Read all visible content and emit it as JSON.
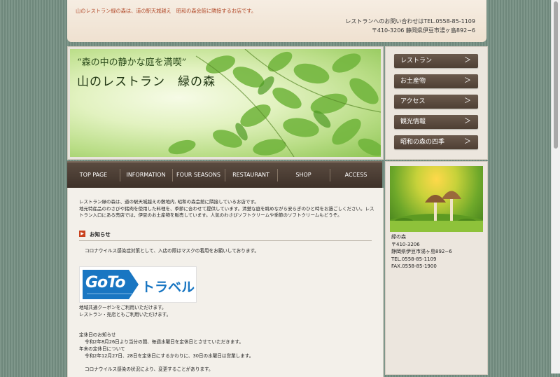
{
  "header": {
    "tagline": "山のレストラン緑の森は、道の駅天城越え　昭和の森会館に隣接するお店です。",
    "contact_line1": "レストランへのお問い合わせはTEL.0558-85-1109",
    "contact_line2": "〒410-3206 静岡県伊豆市湯ヶ島892−6"
  },
  "hero": {
    "catch": "“森の中の静かな庭を満喫”",
    "title": "山のレストラン　緑の森"
  },
  "side_menu": [
    {
      "label": "レストラン"
    },
    {
      "label": "お土産物"
    },
    {
      "label": "アクセス"
    },
    {
      "label": "観光情報"
    },
    {
      "label": "昭和の森の四季"
    }
  ],
  "arrow_glyph": "＞",
  "nav": [
    {
      "label": "TOP PAGE"
    },
    {
      "label": "INFORMATION"
    },
    {
      "label": "FOUR SEASONS"
    },
    {
      "label": "RESTAURANT"
    },
    {
      "label": "SHOP"
    },
    {
      "label": "ACCESS"
    }
  ],
  "content": {
    "intro": "レストラン緑の森は、道の駅天城越えの敷地内, 昭和の森会館に隣接しているお店です。\n地元特産品のわさびや猪肉を使用した料理を、季節に合わせて提供しています。清楚な庭を眺めながら安らぎのひと時をお過ごしください。レストラン入口にある売店では，伊豆のお土産物を販売しています。人気のわさびソフトクリームや季節のソフトクリームもどうぞ。",
    "news_label": "お知らせ",
    "bullet": "▶",
    "covid_notice": "コロナウイルス感染症対策として、入店の際はマスクの着用をお願いしております。",
    "goto_logo": "GoTo",
    "goto_kana": "トラベル",
    "coupon_line1": "地域共通クーポンをご利用いただけます。",
    "coupon_line2": "レストラン・売店ともご利用いただけます。",
    "holiday_title": "定休日のお知らせ",
    "holiday_line1": "令和2年8月26日より当分の間、毎週水曜日を定休日とさせていただきます。",
    "newyear_title": "年末の定休日について",
    "newyear_line1": "令和2年12月27日、28日を定休日にするかわりに、30日の水曜日は営業します。",
    "change_notice": "コロナウイルス感染の状況により、変更することがあります。"
  },
  "sidebar": {
    "name": "緑の森",
    "postal": "〒410-3206",
    "address": "静岡県伊豆市湯ヶ島892−6",
    "tel": "TEL.0558-85-1109",
    "fax": "FAX.0558-85-1900"
  }
}
